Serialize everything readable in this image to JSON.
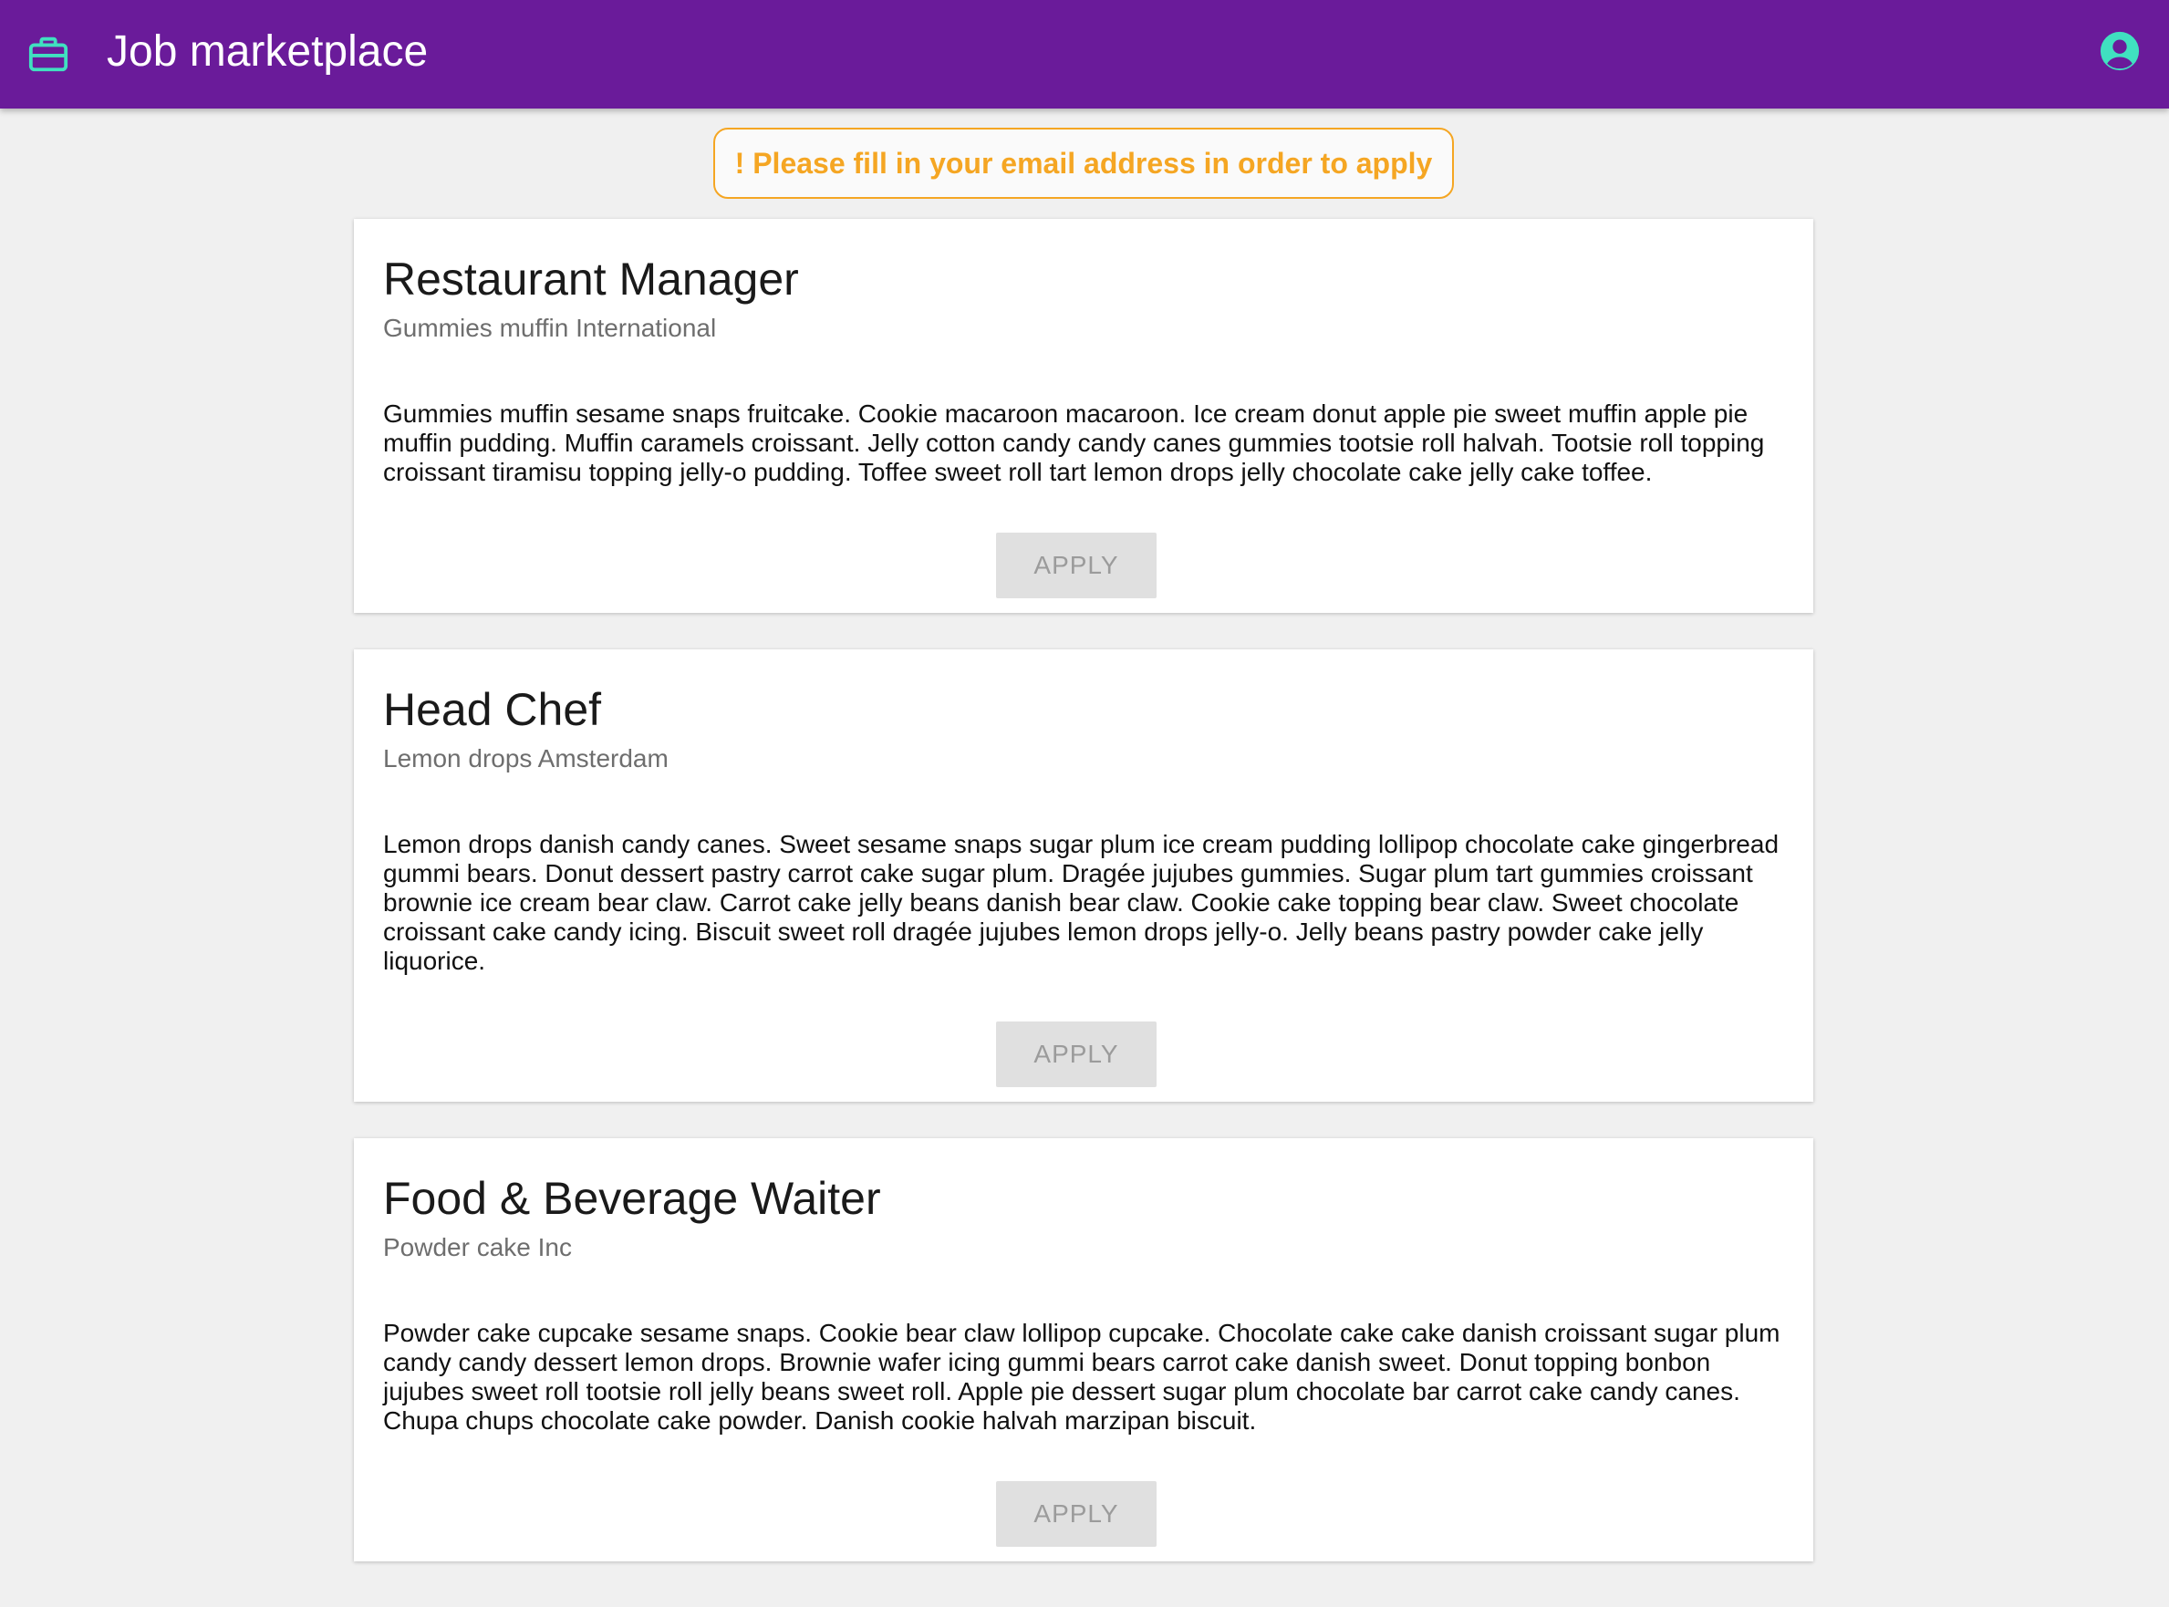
{
  "header": {
    "brand_icon": "briefcase-icon",
    "title": "Job marketplace",
    "account_icon": "account-circle-icon",
    "colors": {
      "bar": "#6a1b9a",
      "icon": "#40e0c0"
    }
  },
  "notice": {
    "text": "! Please fill in your email address in order to apply",
    "color": "#f5a623"
  },
  "jobs": [
    {
      "title": "Restaurant Manager",
      "company": "Gummies muffin International",
      "description": "Gummies muffin sesame snaps fruitcake. Cookie macaroon macaroon. Ice cream donut apple pie sweet muffin apple pie muffin pudding. Muffin caramels croissant. Jelly cotton candy candy canes gummies tootsie roll halvah. Tootsie roll topping croissant tiramisu topping jelly-o pudding. Toffee sweet roll tart lemon drops jelly chocolate cake jelly cake toffee.",
      "apply_label": "APPLY"
    },
    {
      "title": "Head Chef",
      "company": "Lemon drops Amsterdam",
      "description": "Lemon drops danish candy canes. Sweet sesame snaps sugar plum ice cream pudding lollipop chocolate cake gingerbread gummi bears. Donut dessert pastry carrot cake sugar plum. Dragée jujubes gummies. Sugar plum tart gummies croissant brownie ice cream bear claw. Carrot cake jelly beans danish bear claw. Cookie cake topping bear claw. Sweet chocolate croissant cake candy icing. Biscuit sweet roll dragée jujubes lemon drops jelly-o. Jelly beans pastry powder cake jelly liquorice.",
      "apply_label": "APPLY"
    },
    {
      "title": "Food & Beverage Waiter",
      "company": "Powder cake Inc",
      "description": "Powder cake cupcake sesame snaps. Cookie bear claw lollipop cupcake. Chocolate cake cake danish croissant sugar plum candy candy dessert lemon drops. Brownie wafer icing gummi bears carrot cake danish sweet. Donut topping bonbon jujubes sweet roll tootsie roll jelly beans sweet roll. Apple pie dessert sugar plum chocolate bar carrot cake candy canes. Chupa chups chocolate cake powder. Danish cookie halvah marzipan biscuit.",
      "apply_label": "APPLY"
    }
  ]
}
